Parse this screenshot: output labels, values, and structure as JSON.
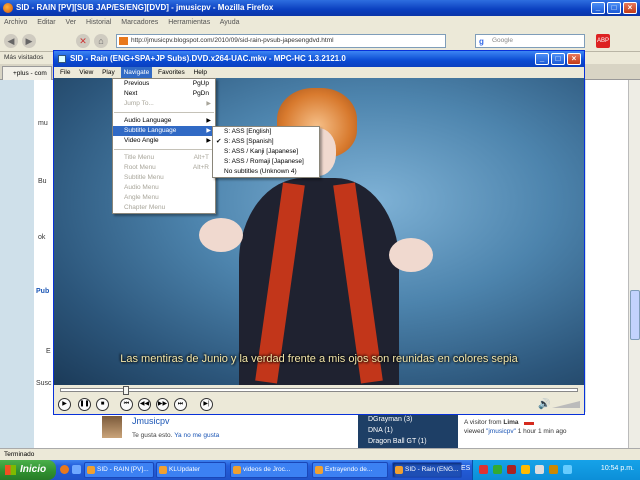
{
  "firefox": {
    "title": "SID - RAIN [PV][SUB JAP/ES/ENG][DVD] - jmusicpv - Mozilla Firefox",
    "menu": [
      "Archivo",
      "Editar",
      "Ver",
      "Historial",
      "Marcadores",
      "Herramientas",
      "Ayuda"
    ],
    "url": "http://jmusicpv.blogspot.com/2010/09/sid-rain-pvsub-japesengdvd.html",
    "search_placeholder": "Google",
    "bookmarks": "Más visitados",
    "tab": "+plus - com",
    "status": "Terminado"
  },
  "page": {
    "left_labels": [
      "mu",
      "Bu",
      "ok",
      "Pub",
      "E",
      "Susc"
    ],
    "comment_user": "Jmusicpv",
    "comment_like": "Te gusta esto.",
    "comment_unlike": "Ya no me gusta",
    "friends": [
      "DGrayman (3)",
      "DNA (1)",
      "Dragon Ball GT (1)"
    ],
    "visitor_line1": "A visitor from",
    "visitor_city": "Lima",
    "visitor_line2": "viewed",
    "visitor_link": "\"jmusicpv\"",
    "visitor_time": "1 hour 1 min ago"
  },
  "mpc": {
    "title": "SID - Rain (ENG+SPA+JP Subs).DVD.x264-UAC.mkv - MPC-HC 1.3.2121.0",
    "menu": [
      "File",
      "View",
      "Play",
      "Navigate",
      "Favorites",
      "Help"
    ],
    "active_menu_index": 3,
    "subtitle": "Las mentiras de Junio y la verdad frente a mis ojos son reunidas en colores sepia",
    "seek_progress": 0.12,
    "volume": 1.0
  },
  "navigate_menu": [
    {
      "label": "Previous",
      "acc": "PgUp"
    },
    {
      "label": "Next",
      "acc": "PgDn"
    },
    {
      "label": "Jump To...",
      "arrow": true,
      "disabled": true
    },
    {
      "sep": true
    },
    {
      "label": "Audio Language",
      "arrow": true
    },
    {
      "label": "Subtitle Language",
      "arrow": true,
      "highlight": true
    },
    {
      "label": "Video Angle",
      "arrow": true
    },
    {
      "sep": true
    },
    {
      "label": "Title Menu",
      "acc": "Alt+T",
      "disabled": true
    },
    {
      "label": "Root Menu",
      "acc": "Alt+R",
      "disabled": true
    },
    {
      "label": "Subtitle Menu",
      "disabled": true
    },
    {
      "label": "Audio Menu",
      "disabled": true
    },
    {
      "label": "Angle Menu",
      "disabled": true
    },
    {
      "label": "Chapter Menu",
      "disabled": true
    }
  ],
  "subtitle_menu": [
    {
      "label": "S: ASS [English]"
    },
    {
      "label": "S: ASS [Spanish]",
      "checked": true
    },
    {
      "label": "S: ASS / Kanji [Japanese]"
    },
    {
      "label": "S: ASS / Romaji [Japanese]"
    },
    {
      "label": "No subtitles (Unknown 4)"
    }
  ],
  "taskbar": {
    "start": "Inicio",
    "items": [
      {
        "label": "SID - RAIN [PV]..."
      },
      {
        "label": "KLUpdater"
      },
      {
        "label": "videos de Jroc..."
      },
      {
        "label": "Extrayendo de..."
      },
      {
        "label": "SID - Rain (ENG...",
        "active": true
      }
    ],
    "lang": "ES",
    "clock": "10:54 p.m."
  }
}
